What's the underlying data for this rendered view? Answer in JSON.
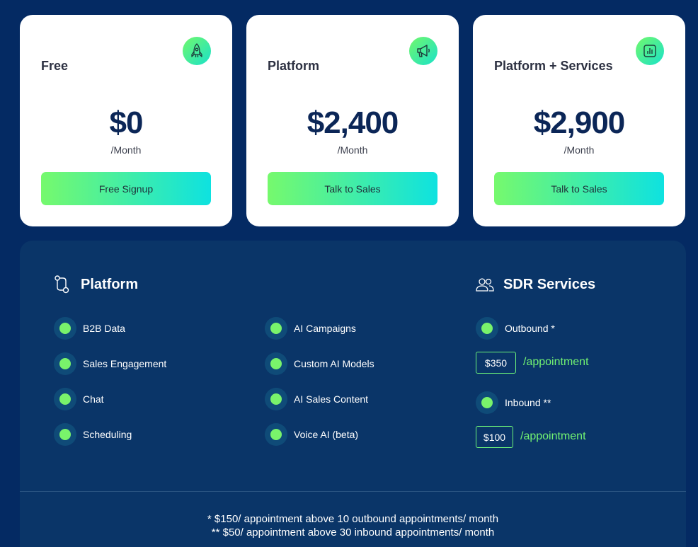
{
  "plans": [
    {
      "title": "Free",
      "price": "$0",
      "period": "/Month",
      "button": "Free Signup",
      "icon": "rocket-icon"
    },
    {
      "title": "Platform",
      "price": "$2,400",
      "period": "/Month",
      "button": "Talk to Sales",
      "icon": "megaphone-icon"
    },
    {
      "title": "Platform + Services",
      "price": "$2,900",
      "period": "/Month",
      "button": "Talk to Sales",
      "icon": "chart-icon"
    }
  ],
  "platform": {
    "heading": "Platform",
    "features_col1": [
      "B2B Data",
      "Sales Engagement",
      "Chat",
      "Scheduling"
    ],
    "features_col2": [
      "AI Campaigns",
      "Custom AI Models",
      "AI Sales Content",
      "Voice AI (beta)"
    ]
  },
  "sdr": {
    "heading": "SDR Services",
    "outbound": {
      "label": "Outbound *",
      "price": "$350",
      "unit": "/appointment"
    },
    "inbound": {
      "label": "Inbound **",
      "price": "$100",
      "unit": "/appointment"
    }
  },
  "footnotes": [
    "* $150/ appointment above 10 outbound appointments/ month",
    "** $50/ appointment above 30 inbound appointments/ month"
  ],
  "colors": {
    "background": "#042a63",
    "panel": "#0a3568",
    "accent_green": "#79f36b",
    "accent_cyan": "#0ee2e0",
    "price_text": "#0b2657"
  }
}
